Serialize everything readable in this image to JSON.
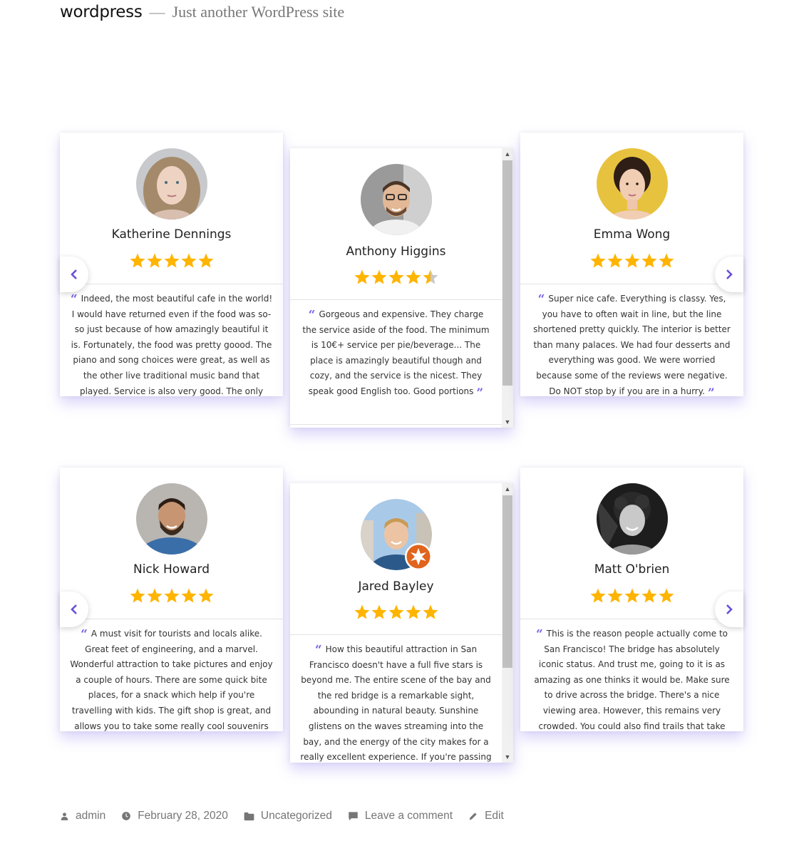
{
  "site": {
    "title": "wordpress",
    "separator": "—",
    "tagline": "Just another WordPress site"
  },
  "colors": {
    "star": "#ffb400",
    "star_empty": "#c8c8c8",
    "accent": "#7b5fe6",
    "meta": "#767676"
  },
  "sliders": [
    {
      "cards": [
        {
          "name": "Katherine Dennings",
          "rating": 5,
          "avatar": "portrait-woman-curly-hair",
          "review": "Indeed, the most beautiful cafe in the world! I would have returned even if the food was so-so just because of how amazingly beautiful it is. Fortunately, the food was pretty goood. The piano and song choices were great, as well as the other live traditional music band that played. Service is also very good. The only downside is the wait"
        },
        {
          "name": "Anthony Higgins",
          "rating": 4.5,
          "avatar": "portrait-man-glasses",
          "review": "Gorgeous and expensive. They charge the service aside of the food. The minimum is 10€+ service per pie/beverage... The place is amazingly beautiful though and cozy, and the service is the nicest. They speak good English too. Good portions"
        },
        {
          "name": "Emma Wong",
          "rating": 5,
          "avatar": "portrait-woman-yellow-background",
          "review": "Super nice cafe. Everything is classy. Yes, you have to often wait in line, but the line shortened pretty quickly. The interior is better than many palaces. We had four desserts and everything was good. We were worried because some of the reviews were negative. Do NOT stop by if you are in a hurry."
        }
      ]
    },
    {
      "cards": [
        {
          "name": "Nick Howard",
          "rating": 5,
          "avatar": "portrait-man-beard-blue-shirt",
          "review": "A must visit for tourists and locals alike. Great feet of engineering, and a marvel. Wonderful attraction to take pictures and enjoy a couple of hours. There are some quick bite places, for a snack which help if you're travelling with kids. The gift shop is great, and allows you to take some really cool souvenirs to remind you of the place."
        },
        {
          "name": "Jared Bayley",
          "rating": 5,
          "avatar": "portrait-young-man-city-badge",
          "review": "How this beautiful attraction in San Francisco doesn't have a full five stars is beyond me. The entire scene of the bay and the red bridge is a remarkable sight, abounding in natural beauty. Sunshine glistens on the waves streaming into the bay, and the energy of the city makes for a really excellent experience. If you're passing through San"
        },
        {
          "name": "Matt O'brien",
          "rating": 5,
          "avatar": "portrait-man-curly-black-white",
          "review": "This is the reason people actually come to San Francisco! The bridge has absolutely iconic status. And trust me, going to it is as amazing as one thinks it would be. Make sure to drive across the bridge. There's a nice viewing area. However, this remains very crowded. You could also find trails that take you down to the bay to get good shots."
        }
      ]
    }
  ],
  "meta": {
    "author": "admin",
    "date": "February 28, 2020",
    "category": "Uncategorized",
    "comment": "Leave a comment",
    "edit": "Edit"
  }
}
